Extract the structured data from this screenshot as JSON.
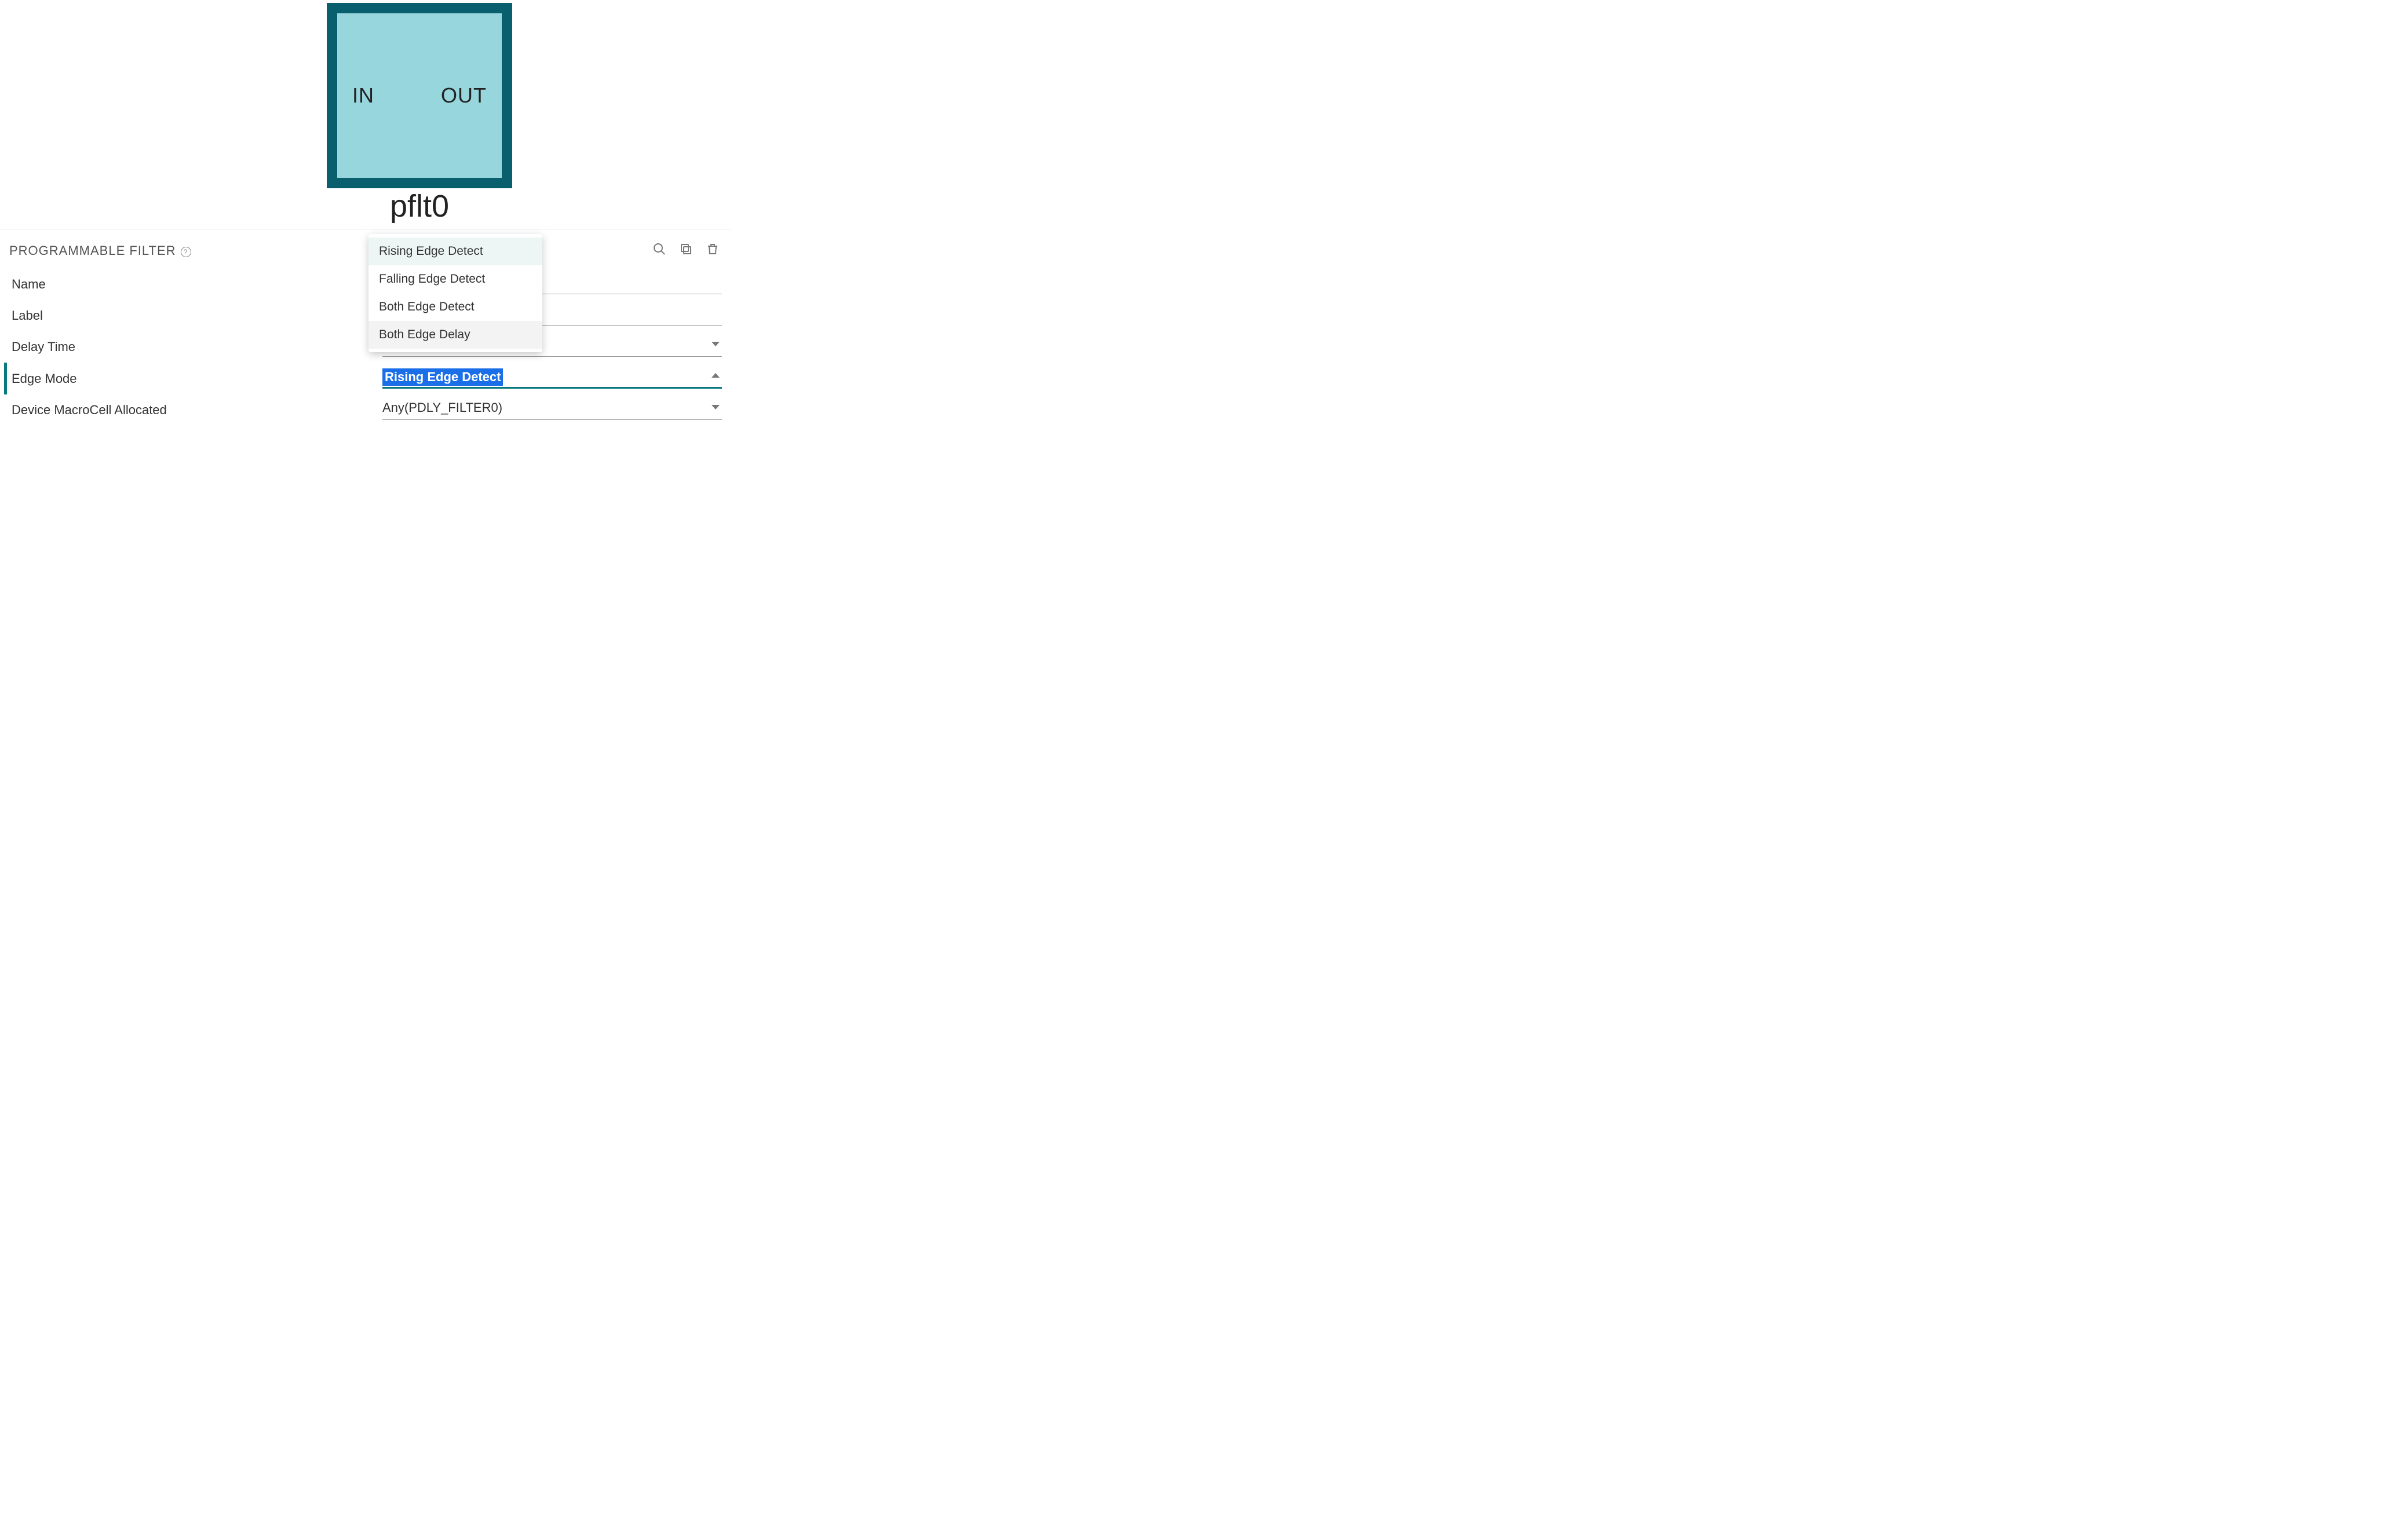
{
  "diagram": {
    "in_label": "IN",
    "out_label": "OUT",
    "block_name": "pflt0"
  },
  "panel": {
    "title": "PROGRAMMABLE FILTER",
    "help_icon": "?",
    "actions": {
      "search_icon": "search",
      "copy_icon": "copy",
      "delete_icon": "delete"
    }
  },
  "properties": {
    "name": {
      "label": "Name",
      "value": ""
    },
    "label": {
      "label": "Label",
      "value": ""
    },
    "delay_time": {
      "label": "Delay Time",
      "value": ""
    },
    "edge_mode": {
      "label": "Edge Mode",
      "value": "Rising Edge Detect"
    },
    "macrocell": {
      "label": "Device MacroCell Allocated",
      "value": "Any(PDLY_FILTER0)"
    }
  },
  "dropdown_options": [
    "Rising Edge Detect",
    "Falling Edge Detect",
    "Both Edge Detect",
    "Both Edge Delay"
  ]
}
